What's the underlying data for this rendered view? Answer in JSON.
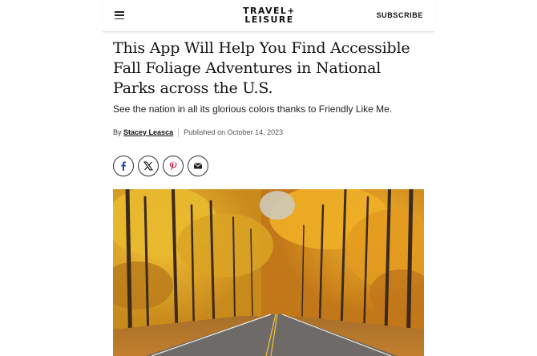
{
  "header": {
    "menu_icon": "hamburger-menu-icon",
    "logo_line1": "TRAVEL+",
    "logo_line2": "LEISURE",
    "subscribe_label": "SUBSCRIBE"
  },
  "article": {
    "title": "This App Will Help You Find Accessible Fall Foliage Adventures in National Parks across the U.S.",
    "subtitle": "See the nation in all its glorious colors thanks to Friendly Like Me.",
    "byline_prefix": "By",
    "author": "Stacey Leasca",
    "published": "Published on October 14, 2023"
  },
  "share": {
    "icons": [
      "facebook-icon",
      "x-twitter-icon",
      "pinterest-icon",
      "email-icon"
    ]
  },
  "hero_image": {
    "subject": "autumn-forest-road",
    "colors": {
      "foliage": "#e0a526",
      "road": "#6d6a68",
      "center_line": "#e8b93a",
      "trunk": "#3c2a1a"
    }
  }
}
